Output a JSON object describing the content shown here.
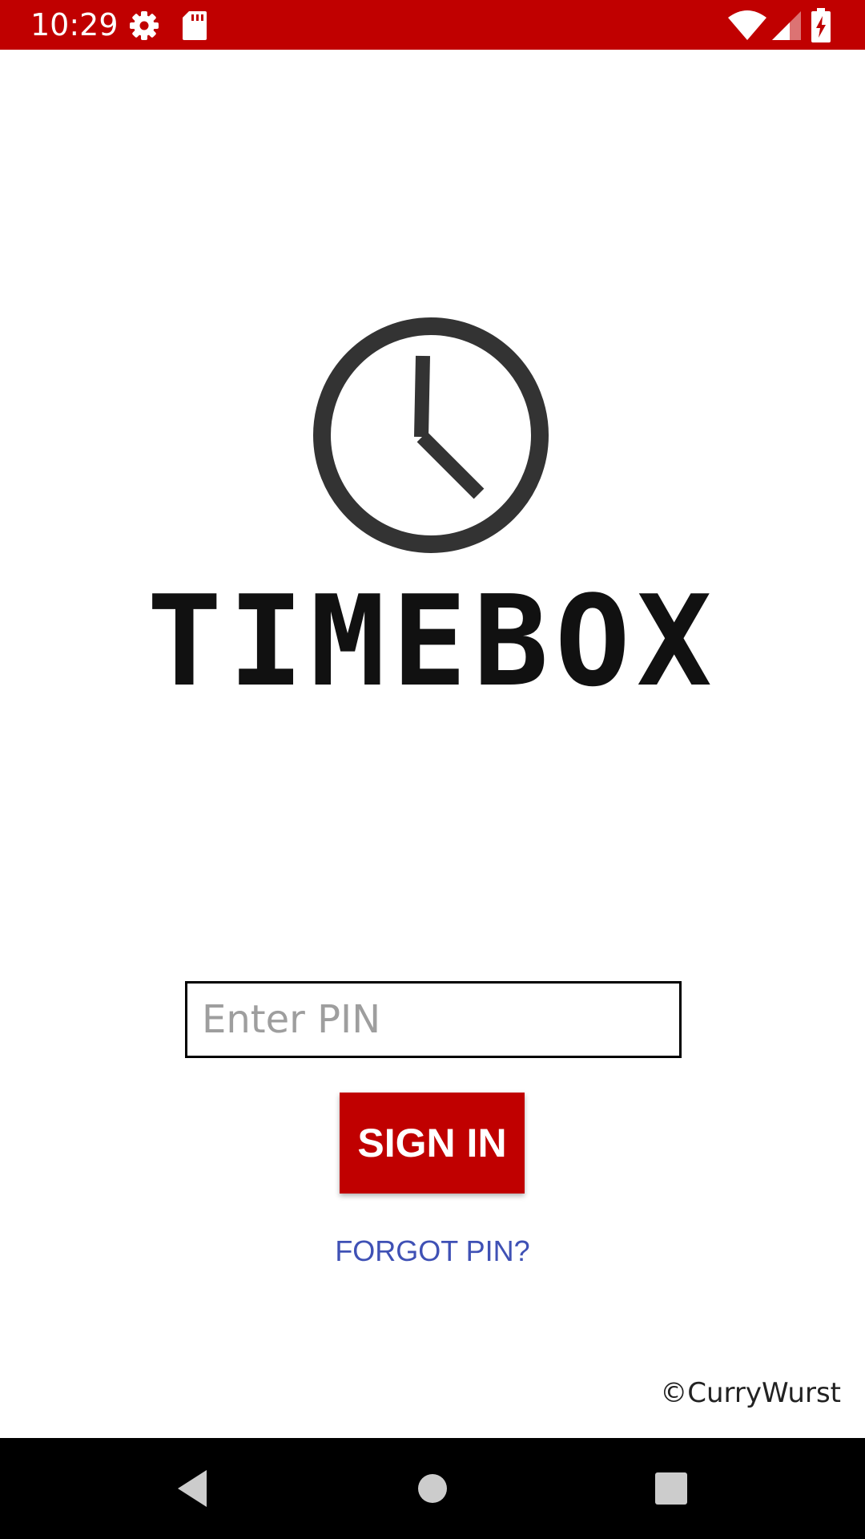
{
  "status_bar": {
    "time": "10:29",
    "icons": [
      "gear-icon",
      "sd-card-icon",
      "wifi-icon",
      "signal-icon",
      "battery-charging-icon"
    ],
    "background_color": "#c00000"
  },
  "logo": {
    "icon": "clock-icon",
    "wordmark": "TIMEBOX"
  },
  "login": {
    "pin_placeholder": "Enter PIN",
    "pin_value": "",
    "sign_in_label": "SIGN IN",
    "forgot_label": "FORGOT PIN?",
    "accent_color": "#c00000",
    "link_color": "#3f51b5"
  },
  "footer": {
    "copyright": "©CurryWurst"
  },
  "nav_bar": {
    "icons": [
      "back-icon",
      "home-icon",
      "recents-icon"
    ]
  }
}
